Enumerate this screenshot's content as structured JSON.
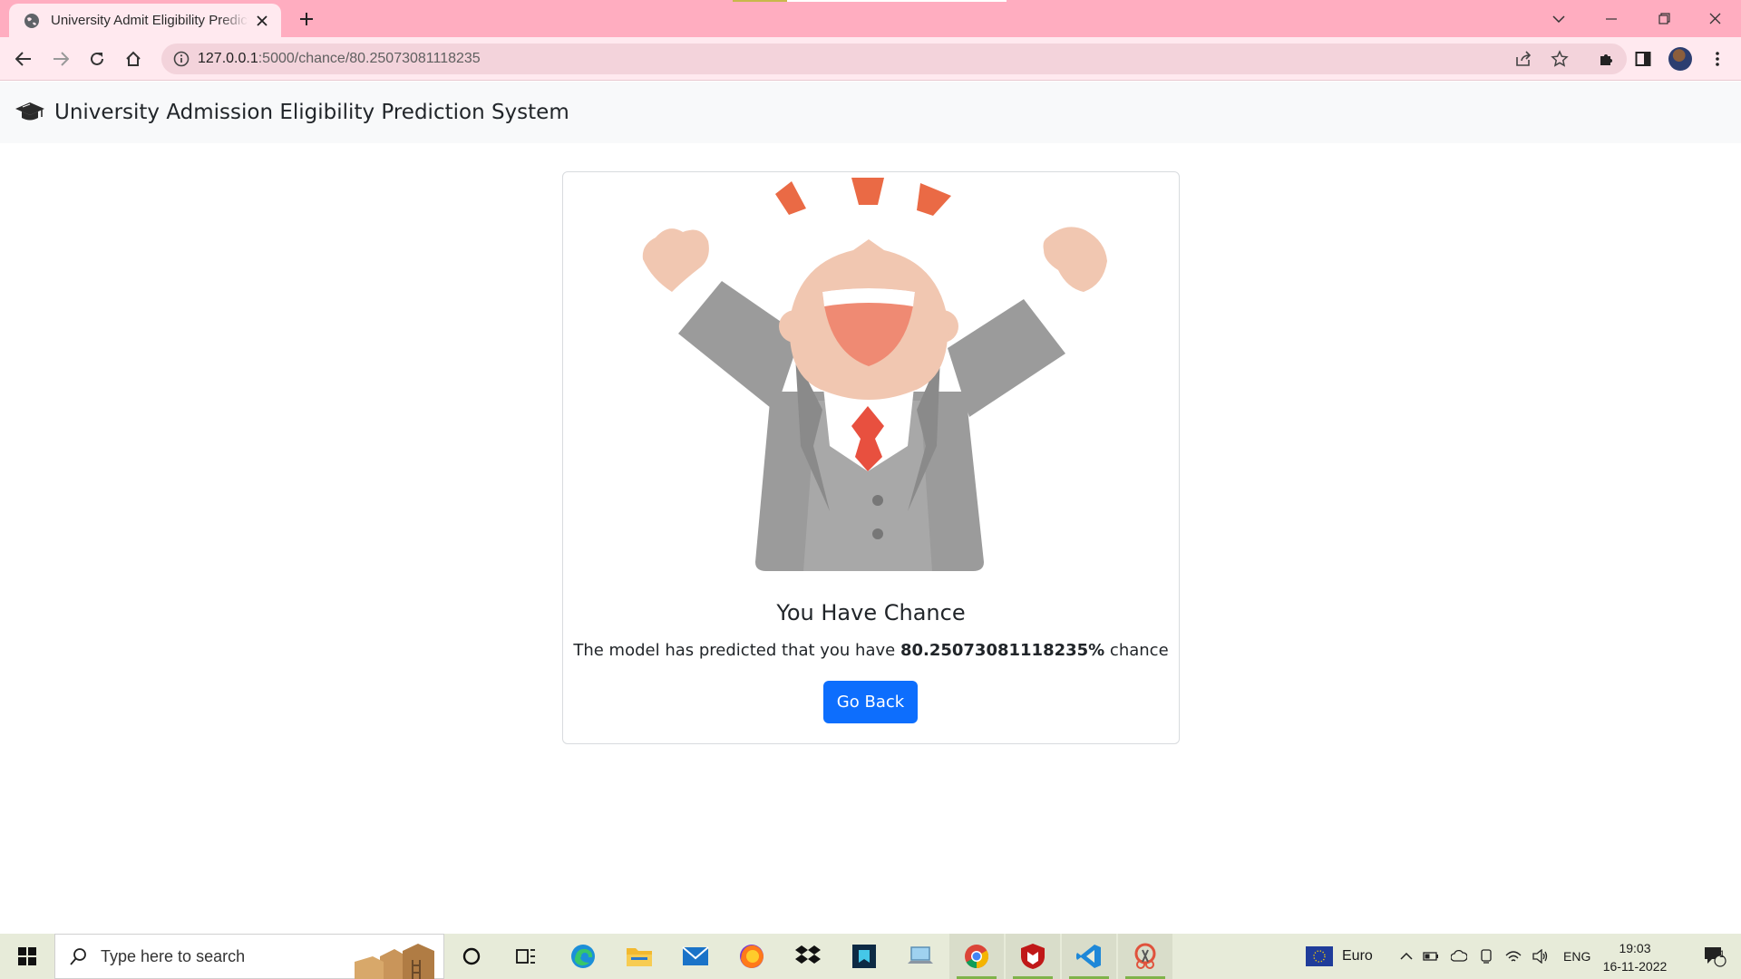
{
  "browser": {
    "tab_title": "University Admit Eligibility Prediction System",
    "url_host": "127.0.0.1",
    "url_rest": ":5000/chance/80.25073081118235"
  },
  "navbar": {
    "brand": "University Admission Eligibility Prediction System",
    "brand_icon": "graduation-cap-icon"
  },
  "card": {
    "heading": "You Have Chance",
    "message_prefix": "The model has predicted that you have ",
    "chance_value": "80.25073081118235%",
    "message_suffix": " chance",
    "button_label": "Go Back"
  },
  "taskbar": {
    "search_placeholder": "Type here to search",
    "currency_label": "Euro",
    "language": "ENG",
    "time": "19:03",
    "date": "16-11-2022",
    "notification_count": "1"
  },
  "colors": {
    "tab_strip": "#ffadc0",
    "toolbar": "#ffe9ef",
    "button_primary": "#0d6efd",
    "navbar_bg": "#f8f9fa"
  }
}
